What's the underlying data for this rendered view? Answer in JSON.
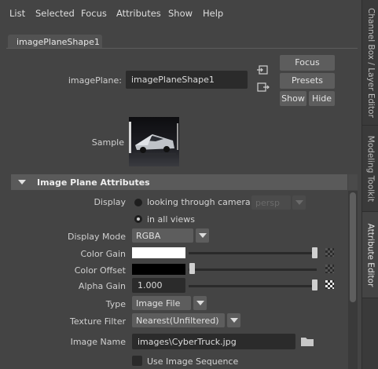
{
  "menu": [
    "List",
    "Selected",
    "Focus",
    "Attributes",
    "Show",
    "Help"
  ],
  "side_tabs": [
    "Channel Box / Layer Editor",
    "Modeling Toolkit",
    "Attribute Editor"
  ],
  "node_tab": "imagePlaneShape1",
  "node_field": {
    "label": "imagePlane:",
    "value": "imagePlaneShape1"
  },
  "buttons": {
    "focus": "Focus",
    "presets": "Presets",
    "show": "Show",
    "hide": "Hide"
  },
  "sample_label": "Sample",
  "section": {
    "title": "Image Plane Attributes",
    "expanded": true
  },
  "display": {
    "label": "Display",
    "option_camera": "looking through camera",
    "camera_value": "persp",
    "option_all": "in all views",
    "selected": "in all views"
  },
  "display_mode": {
    "label": "Display Mode",
    "value": "RGBA"
  },
  "color_gain": {
    "label": "Color Gain",
    "color": "#ffffff",
    "slider": 1.0
  },
  "color_offset": {
    "label": "Color Offset",
    "color": "#000000",
    "slider": 0.0
  },
  "alpha_gain": {
    "label": "Alpha Gain",
    "value": "1.000",
    "slider": 1.0
  },
  "type": {
    "label": "Type",
    "value": "Image File"
  },
  "texture_filter": {
    "label": "Texture Filter",
    "value": "Nearest(Unfiltered)"
  },
  "image_name": {
    "label": "Image Name",
    "value": "images\\CyberTruck.jpg"
  },
  "use_image_sequence": {
    "label": "Use Image Sequence",
    "checked": false
  }
}
